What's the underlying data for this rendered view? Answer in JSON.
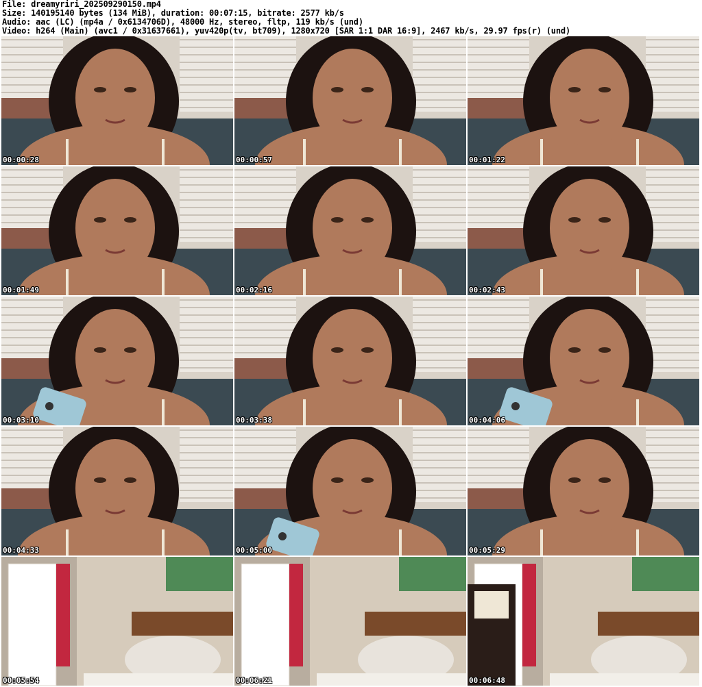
{
  "header": {
    "file": "File: dreamyriri_202509290150.mp4",
    "size": "Size: 140195140 bytes (134 MiB), duration: 00:07:15, bitrate: 2577 kb/s",
    "audio": "Audio: aac (LC) (mp4a / 0x6134706D), 48000 Hz, stereo, fltp, 119 kb/s (und)",
    "video": "Video: h264 (Main) (avc1 / 0x31637661), yuv420p(tv, bt709), 1280x720 [SAR 1:1 DAR 16:9], 2467 kb/s, 29.97 fps(r) (und)"
  },
  "thumbnails": [
    {
      "time": "00:00:28",
      "scene": "face"
    },
    {
      "time": "00:00:57",
      "scene": "face"
    },
    {
      "time": "00:01:22",
      "scene": "face"
    },
    {
      "time": "00:01:49",
      "scene": "face"
    },
    {
      "time": "00:02:16",
      "scene": "face"
    },
    {
      "time": "00:02:43",
      "scene": "face"
    },
    {
      "time": "00:03:10",
      "scene": "face-phone"
    },
    {
      "time": "00:03:38",
      "scene": "face"
    },
    {
      "time": "00:04:06",
      "scene": "face-phone"
    },
    {
      "time": "00:04:33",
      "scene": "face"
    },
    {
      "time": "00:05:00",
      "scene": "face-phone"
    },
    {
      "time": "00:05:29",
      "scene": "face"
    },
    {
      "time": "00:05:54",
      "scene": "room"
    },
    {
      "time": "00:06:21",
      "scene": "room"
    },
    {
      "time": "00:06:48",
      "scene": "room"
    }
  ],
  "colors": {
    "wall": "#d9d2c8",
    "blinds": "#ece8e2",
    "skin": "#b07a5c",
    "hair": "#1c1210",
    "top": "#efe7d6",
    "bedding": "#3b4a52",
    "roomWall": "#d6cbbb",
    "headboard": "#7a4a2a",
    "pillow": "#e8e3dc"
  }
}
